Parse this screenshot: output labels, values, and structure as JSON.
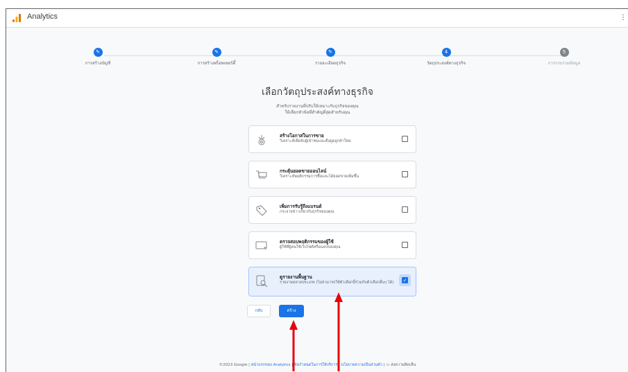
{
  "app": {
    "title": "Analytics",
    "menu_icon": "more-vert-icon"
  },
  "stepper": {
    "steps": [
      {
        "label": "การสร้างบัญชี",
        "marker": "✎",
        "status": "completed"
      },
      {
        "label": "การสร้างพร็อพเพอร์ตี้",
        "marker": "✎",
        "status": "completed"
      },
      {
        "label": "รายละเอียดธุรกิจ",
        "marker": "✎",
        "status": "completed"
      },
      {
        "label": "วัตถุประสงค์ทางธุรกิจ",
        "marker": "4",
        "status": "current"
      },
      {
        "label": "การรวบรวมข้อมูล",
        "marker": "5",
        "status": "todo"
      }
    ]
  },
  "main": {
    "heading": "เลือกวัตถุประสงค์ทางธุรกิจ",
    "subheading_line1": "สำหรับรายงานที่ปรับให้เหมาะกับธุรกิจของคุณ",
    "subheading_line2": "ให้เลือกหัวข้อที่สำคัญที่สุดสำหรับคุณ",
    "options": [
      {
        "title": "สร้างโอกาสในการขาย",
        "description": "วิเคราะห์เพื่อจับผู้เข้าชมและดึงดูดลูกค้าใหม่",
        "icon": "leads-target-icon",
        "checked": false
      },
      {
        "title": "กระตุ้นยอดขายออนไลน์",
        "description": "วิเคราะห์พฤติกรรมการซื้อและได้ยอดขายเพิ่มขึ้น",
        "icon": "shopping-cart-icon",
        "checked": false
      },
      {
        "title": "เพิ่มการรับรู้ถึงแบรนด์",
        "description": "กระจายข่าวเกี่ยวกับธุรกิจของคุณ",
        "icon": "tag-icon",
        "checked": false
      },
      {
        "title": "ตรวจสอบพฤติกรรมของผู้ใช้",
        "description": "ผู้ใช้ที่ผู้คนใช้เว็บไซต์หรือแอปของคุณ",
        "icon": "screen-cursor-icon",
        "checked": false
      },
      {
        "title": "ดูรายงานพื้นฐาน",
        "description": "รายงานหลายประเภท (ไม่สามารถใช้ตัวเลือกนี้ร่วมกับตัวเลือกอื่นๆ ได้)",
        "icon": "report-search-icon",
        "checked": true
      }
    ],
    "back_label": "กลับ",
    "create_label": "สร้าง"
  },
  "footer": {
    "copyright": "©2023 Google",
    "sep": "|",
    "link_home": "หน้าแรกของ Analytics",
    "link_terms": "ข้อกำหนดในการให้บริการ",
    "link_privacy": "นโยบายความเป็นส่วนตัว",
    "feedback": "ส่งความคิดเห็น"
  },
  "colors": {
    "accent": "#1a73e8",
    "annotation": "#e8000b"
  }
}
